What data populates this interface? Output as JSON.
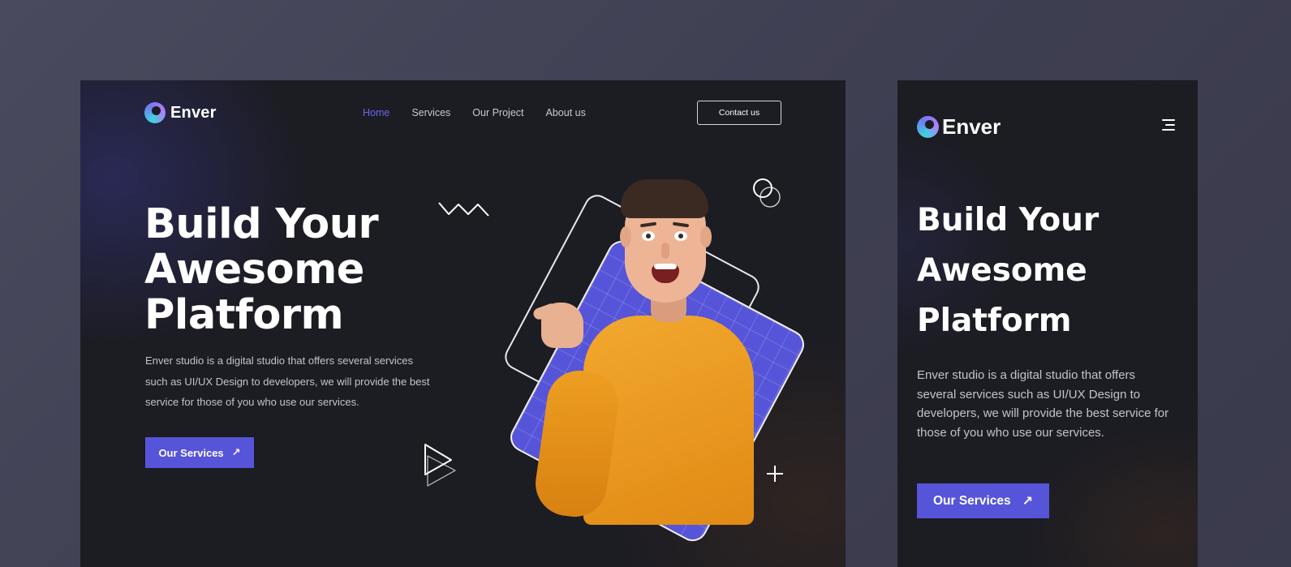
{
  "brand": {
    "name": "Enver",
    "icon": "enver-logo-icon",
    "colors": {
      "accent": "#5654d8",
      "background": "#1c1c23",
      "sweater": "#f2a82e"
    }
  },
  "desktop": {
    "nav": [
      {
        "label": "Home",
        "active": true
      },
      {
        "label": "Services",
        "active": false
      },
      {
        "label": "Our Project",
        "active": false
      },
      {
        "label": "About us",
        "active": false
      }
    ],
    "contact_label": "Contact us",
    "hero": {
      "title_lines": [
        "Build Your",
        "Awesome",
        "Platform"
      ],
      "description": "Enver studio is a digital studio that offers several services such as UI/UX Design to developers, we will provide the best service for those of you who use our services.",
      "cta_label": "Our Services",
      "cta_icon": "arrow-up-right-icon"
    }
  },
  "mobile": {
    "menu_icon": "hamburger-menu-icon",
    "hero": {
      "title_lines": [
        "Build Your",
        "Awesome",
        "Platform"
      ],
      "description": "Enver studio is a digital studio that offers several services such as UI/UX Design to developers, we will provide the best service for those of you who use our services.",
      "cta_label": "Our Services",
      "cta_icon": "arrow-up-right-icon"
    }
  }
}
